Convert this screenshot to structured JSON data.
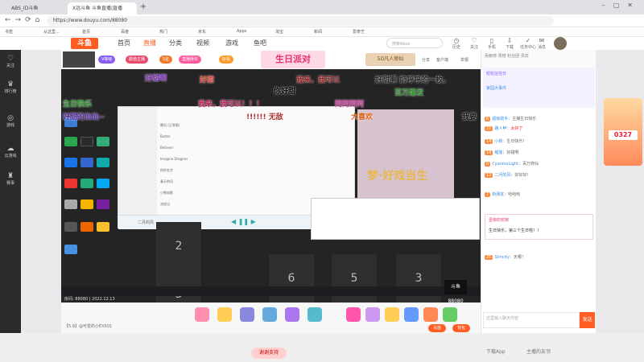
{
  "browser": {
    "tabs": [
      "ABS_ID斗鱼",
      "X远斗鱼 斗鱼直播|直播"
    ],
    "new_tab": "+",
    "url": "https://www.douyu.com/88080",
    "bookmarks": [
      "书签",
      "从这里...",
      "首页",
      "百度",
      "热门",
      "京东",
      "Apps",
      "淘宝",
      "新闻",
      "爱奇艺"
    ]
  },
  "site": {
    "logo": "斗鱼",
    "nav": [
      "首页",
      "直播",
      "分类",
      "视频",
      "游戏",
      "鱼吧"
    ],
    "search_placeholder": "搜索Abox",
    "header_icons": [
      "历史",
      "关注",
      "手机",
      "下载",
      "任务中心",
      "消息"
    ]
  },
  "left_rail": [
    "关注",
    "排行榜",
    "游戏",
    "云游戏",
    "赛事",
    "更多"
  ],
  "stream": {
    "badges": [
      "V等级",
      "颜值主播",
      "5星",
      "直播拜年",
      "好看"
    ],
    "birthday_banner": "生日派对",
    "banner_5d": "5D凡人修仙",
    "header_links": [
      "分享",
      "客户端",
      "举报"
    ],
    "caption": "房间: 88080 | 2022.12.13",
    "watermark": "斗鱼 88080"
  },
  "video": {
    "key_numbers": [
      "2",
      "3",
      "6",
      "5",
      "3"
    ],
    "anime_title": "梦·好戏当生",
    "music_songs": [
      "晚风 (正常版)",
      "Butter",
      "Believer",
      "Imagine Dragons",
      "你的名字",
      "春天的风",
      "小熊电影",
      "流浪记"
    ],
    "music_title": "二月的风"
  },
  "danmaku": [
    {
      "text": "好甜啊",
      "color": "#7a2fb5"
    },
    {
      "text": "好甜",
      "color": "#e04030"
    },
    {
      "text": "我来，我可以",
      "color": "#9b1c1c"
    },
    {
      "text": "好甜啊 奶呼呼的一枚。",
      "color": "#222"
    },
    {
      "text": "百万爆发",
      "color": "#2a8a2a"
    },
    {
      "text": "我来，我可以！！！",
      "color": "#c02060"
    },
    {
      "text": "你好甜",
      "color": "#000"
    },
    {
      "text": "阿阿阿阿",
      "color": "#cc3399"
    },
    {
      "text": "!!!!!! 无敌",
      "color": "#b03030"
    },
    {
      "text": "大喜欢",
      "color": "#e06010"
    },
    {
      "text": "我要",
      "color": "#111"
    },
    {
      "text": "生日快乐",
      "color": "#2a9a2a"
    },
    {
      "text": "好甜的仙仙~",
      "color": "#5a2aa5"
    }
  ],
  "gifts": {
    "meta": "【5.9】@可爱的小EX501",
    "recharge": "充值",
    "backpack": "背包"
  },
  "chat": {
    "rank_header": "贡献榜 周榜 粉丝团 贵宾",
    "pinned_title": "轻松征信日",
    "event_title": "家园大事件",
    "messages": [
      {
        "lv": "6",
        "name": "超级助手",
        "text": "主播生日快乐"
      },
      {
        "lv": "21",
        "name": "路人甲",
        "text": "太好了"
      },
      {
        "lv": "14",
        "name": "小新",
        "text": "生日快乐！"
      },
      {
        "lv": "18",
        "name": "榴莲",
        "text": "好甜啊"
      },
      {
        "lv": "9",
        "name": "CyanineLight",
        "text": "百万修仙"
      },
      {
        "lv": "12",
        "name": "二月的风",
        "text": "好好好！"
      },
      {
        "lv": "7",
        "name": "新朋友",
        "text": "哈哈哈"
      },
      {
        "lv": "25",
        "name": "Simcity",
        "text": "天哪！"
      }
    ],
    "birthday_card_title": "壹柳的贰柳",
    "birthday_card_text": "生日快乐，第三个生日啦！！",
    "input_placeholder": "这里输入聊天内容",
    "send": "发送"
  },
  "promo": {
    "count": "0327"
  },
  "footer": {
    "banner": "谢谢支持",
    "links": [
      "下载App",
      "主播的友邻"
    ]
  },
  "colors": {
    "accent": "#ff5d23",
    "chat_bg": "#ffffff",
    "video_bg": "#0d0d0d"
  }
}
